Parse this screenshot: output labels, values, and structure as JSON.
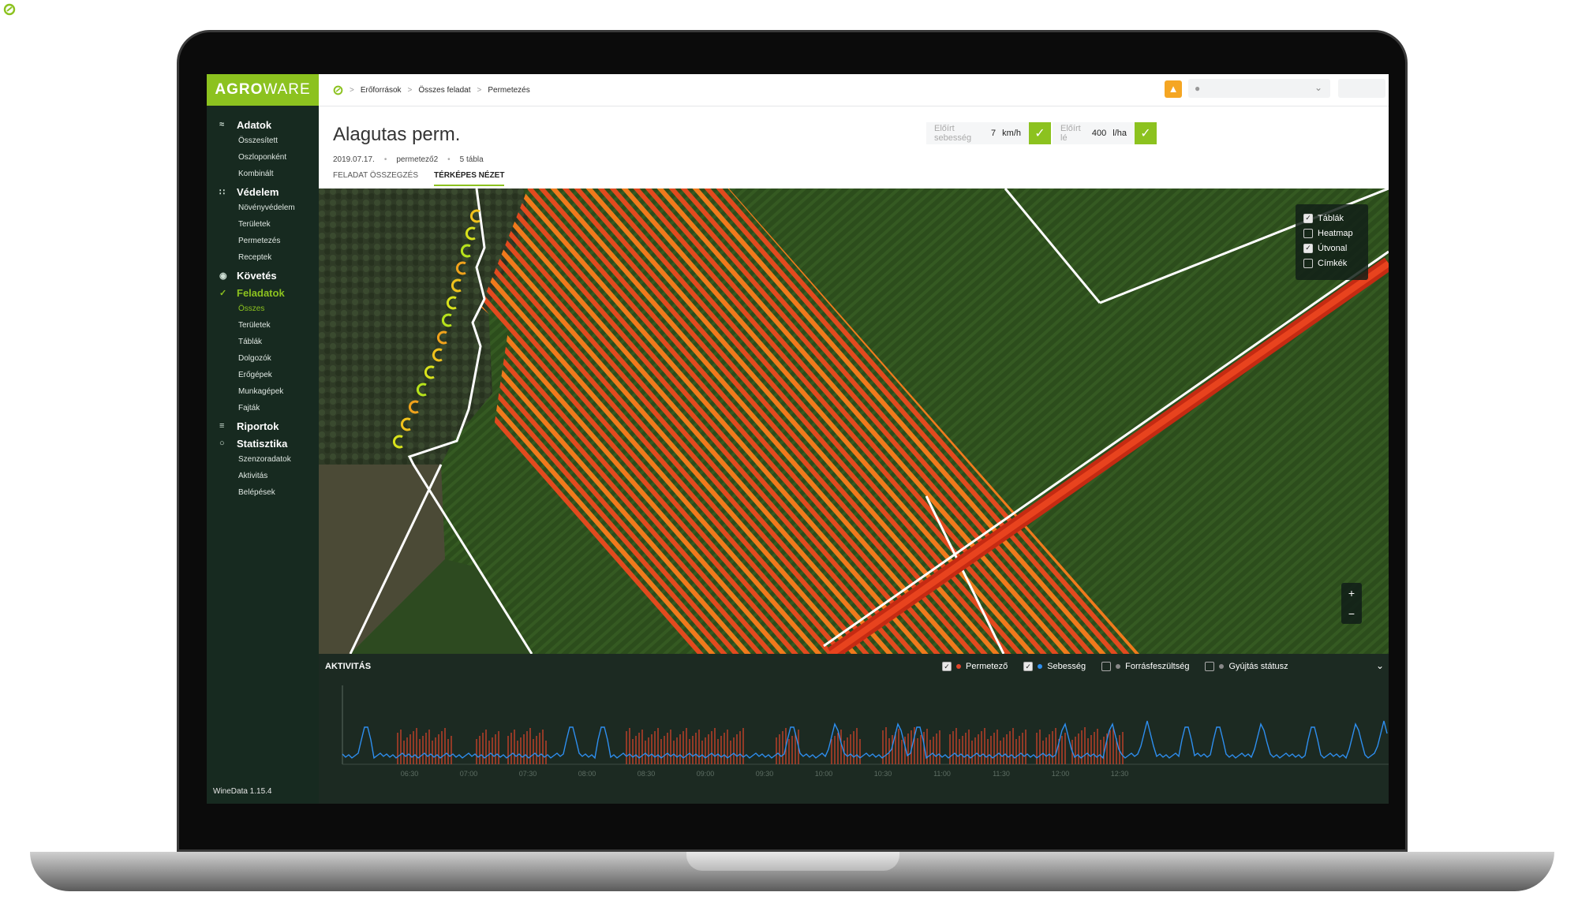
{
  "app": {
    "brand_left": "AGR",
    "brand_o": "O",
    "brand_right": "WARE",
    "version": "WineData 1.15.4"
  },
  "breadcrumb": [
    "Erőforrások",
    "Összes feladat",
    "Permetezés"
  ],
  "sidebar": [
    {
      "label": "Adatok",
      "icon": "chart-line-icon",
      "items": [
        "Összesített",
        "Oszloponként",
        "Kombinált"
      ]
    },
    {
      "label": "Védelem",
      "icon": "sprayer-icon",
      "items": [
        "Növényvédelem",
        "Területek",
        "Permetezés",
        "Receptek"
      ]
    },
    {
      "label": "Követés",
      "icon": "signal-icon",
      "items": []
    },
    {
      "label": "Feladatok",
      "icon": "check-icon",
      "active": true,
      "items": [
        "Összes",
        "Területek",
        "Táblák",
        "Dolgozók",
        "Erőgépek",
        "Munkagépek",
        "Fajták"
      ],
      "active_item": "Összes"
    },
    {
      "label": "Riportok",
      "icon": "list-icon",
      "items": []
    },
    {
      "label": "Statisztika",
      "icon": "circle-icon",
      "items": [
        "Szenzoradatok",
        "Aktivitás",
        "Belépések"
      ]
    }
  ],
  "task": {
    "title": "Alagutas perm.",
    "date": "2019.07.17.",
    "machine": "permetező2",
    "tables": "5 tábla"
  },
  "tabs": [
    {
      "label": "FELADAT ÖSSZEGZÉS",
      "active": false
    },
    {
      "label": "TÉRKÉPES NÉZET",
      "active": true
    }
  ],
  "params": {
    "speed_label": "Előírt sebesség",
    "speed_value": "7",
    "speed_unit": "km/h",
    "fluid_label": "Előírt lé",
    "fluid_value": "400",
    "fluid_unit": "l/ha"
  },
  "map_layers": [
    {
      "label": "Táblák",
      "checked": true
    },
    {
      "label": "Heatmap",
      "checked": false
    },
    {
      "label": "Útvonal",
      "checked": true
    },
    {
      "label": "Címkék",
      "checked": false
    }
  ],
  "zoom": {
    "in": "+",
    "out": "−"
  },
  "activity": {
    "title": "AKTIVITÁS",
    "series": [
      {
        "label": "Permetező",
        "checked": true,
        "color": "#e0452b"
      },
      {
        "label": "Sebesség",
        "checked": true,
        "color": "#2e8ff0"
      },
      {
        "label": "Forrásfeszültség",
        "checked": false,
        "color": "#888888"
      },
      {
        "label": "Gyújtás státusz",
        "checked": false,
        "color": "#888888"
      }
    ],
    "time_labels": [
      "06:30",
      "07:00",
      "07:30",
      "08:00",
      "08:30",
      "09:00",
      "09:30",
      "10:00",
      "10:30",
      "11:00",
      "11:30",
      "12:00",
      "12:30"
    ]
  },
  "colors": {
    "accent": "#8cc21f",
    "sidebar": "#172a20",
    "bell": "#f5a623",
    "track": "#e0452b"
  }
}
